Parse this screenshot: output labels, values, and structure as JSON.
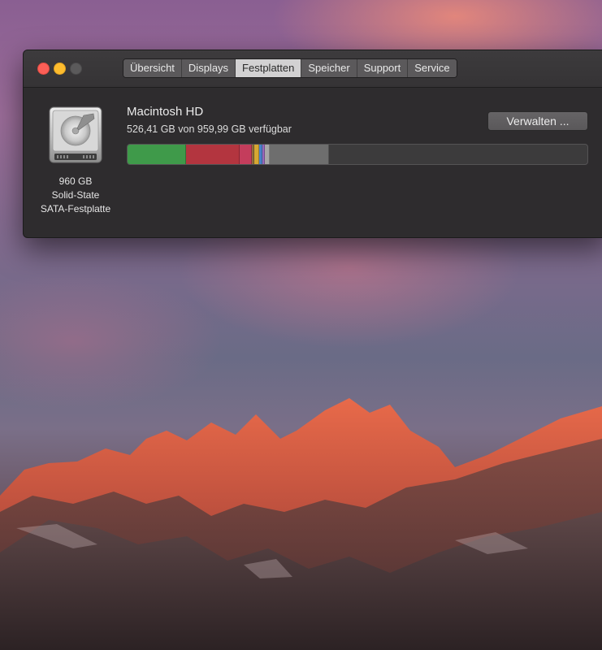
{
  "window": {
    "tabs": [
      {
        "label": "Übersicht",
        "active": false
      },
      {
        "label": "Displays",
        "active": false
      },
      {
        "label": "Festplatten",
        "active": true
      },
      {
        "label": "Speicher",
        "active": false
      },
      {
        "label": "Support",
        "active": false
      },
      {
        "label": "Service",
        "active": false
      }
    ]
  },
  "disk": {
    "icon": "hard-drive-icon",
    "capacity": "960 GB",
    "type_line1": "Solid-State",
    "type_line2": "SATA-Festplatte",
    "name": "Macintosh HD",
    "available": "526,41 GB von 959,99 GB verfügbar",
    "manage_label": "Verwalten ...",
    "usage_segments": [
      {
        "name": "segment-1",
        "fraction": 0.128,
        "color": "#3f9a4a"
      },
      {
        "name": "segment-2",
        "fraction": 0.116,
        "color": "#b3353f"
      },
      {
        "name": "segment-3",
        "fraction": 0.027,
        "color": "#c43d5c"
      },
      {
        "name": "segment-4",
        "fraction": 0.004,
        "color": "#8e6f3b"
      },
      {
        "name": "segment-5",
        "fraction": 0.011,
        "color": "#d6a733"
      },
      {
        "name": "segment-6",
        "fraction": 0.007,
        "color": "#4a82c8"
      },
      {
        "name": "segment-7",
        "fraction": 0.005,
        "color": "#9a67b8"
      },
      {
        "name": "segment-8",
        "fraction": 0.011,
        "color": "#a8a8a8"
      },
      {
        "name": "segment-9",
        "fraction": 0.13,
        "color": "#6e6e6e"
      }
    ]
  }
}
